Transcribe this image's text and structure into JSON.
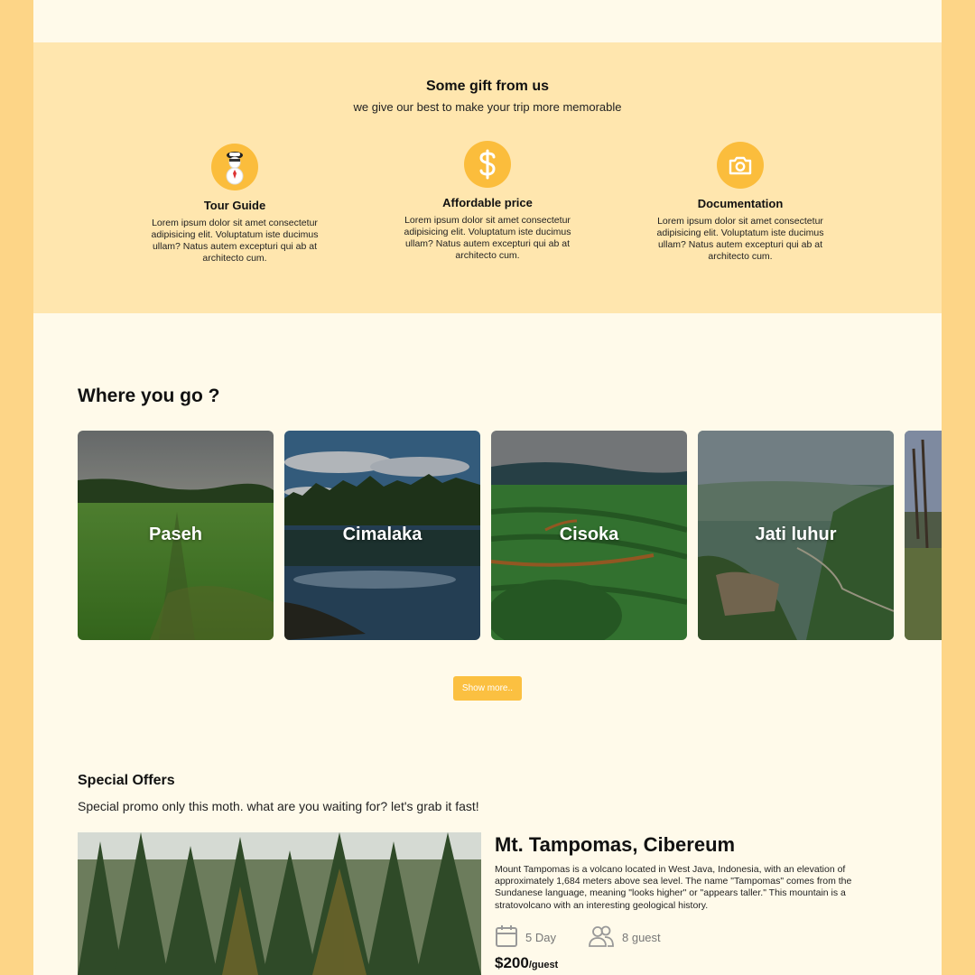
{
  "gift": {
    "title": "Some gift from us",
    "subtitle": "we give our best to make your trip more memorable",
    "features": [
      {
        "icon": "tour-guide-icon",
        "title": "Tour Guide",
        "desc": "Lorem ipsum dolor sit amet consectetur adipisicing elit. Voluptatum iste ducimus ullam? Natus autem excepturi qui ab at architecto cum."
      },
      {
        "icon": "dollar-icon",
        "title": "Affordable price",
        "desc": "Lorem ipsum dolor sit amet consectetur adipisicing elit. Voluptatum iste ducimus ullam? Natus autem excepturi qui ab at architecto cum."
      },
      {
        "icon": "camera-icon",
        "title": "Documentation",
        "desc": "Lorem ipsum dolor sit amet consectetur adipisicing elit. Voluptatum iste ducimus ullam? Natus autem excepturi qui ab at architecto cum."
      }
    ]
  },
  "destinations": {
    "title": "Where you go ?",
    "cards": [
      {
        "label": "Paseh"
      },
      {
        "label": "Cimalaka"
      },
      {
        "label": "Cisoka"
      },
      {
        "label": "Jati luhur"
      },
      {
        "label": ""
      }
    ],
    "show_more": "Show more.."
  },
  "offers": {
    "title": "Special Offers",
    "subtitle": "Special promo only this moth. what are you waiting for? let's grab it fast!",
    "item": {
      "name": "Mt. Tampomas, Cibereum",
      "description": "Mount Tampomas is a volcano located in West Java, Indonesia, with an elevation of approximately 1,684 meters above sea level. The name \"Tampomas\" comes from the Sundanese language, meaning \"looks higher\" or \"appears taller.\" This mountain is a stratovolcano with an interesting geological history.",
      "duration": "5 Day",
      "guests": "8 guest",
      "price": "$200",
      "price_unit": "/guest"
    }
  },
  "colors": {
    "outer_bg": "#fdd587",
    "page_bg": "#fffaea",
    "gift_bg": "#ffe6ae",
    "accent": "#fbbd3c"
  }
}
